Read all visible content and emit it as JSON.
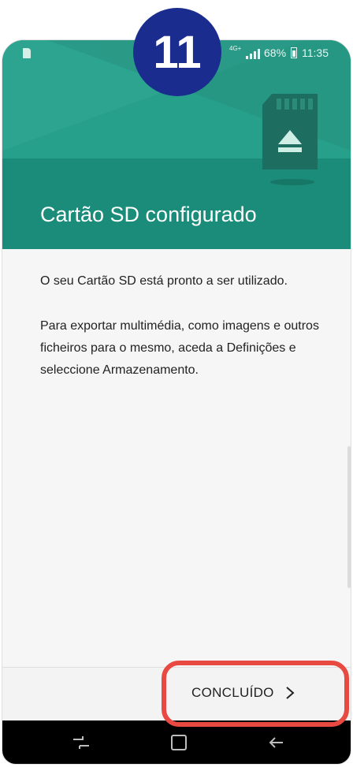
{
  "step_badge": "11",
  "status_bar": {
    "network": "4G+",
    "battery": "68%",
    "time": "11:35"
  },
  "header": {
    "title": "Cartão SD configurado"
  },
  "content": {
    "line1": "O seu Cartão SD está pronto a ser utilizado.",
    "line2": "Para exportar multimédia, como imagens e outros ficheiros para o mesmo, aceda a Definições e seleccione Armazenamento."
  },
  "footer": {
    "done_label": "CONCLUÍDO"
  },
  "icons": {
    "sd": "sd-card-eject-icon",
    "next": "chevron-right-icon",
    "nav_recent": "recent-apps-icon",
    "nav_home": "home-icon",
    "nav_back": "back-icon"
  },
  "colors": {
    "header": "#249a86",
    "badge": "#1b2c8f",
    "highlight": "#e84a42"
  }
}
